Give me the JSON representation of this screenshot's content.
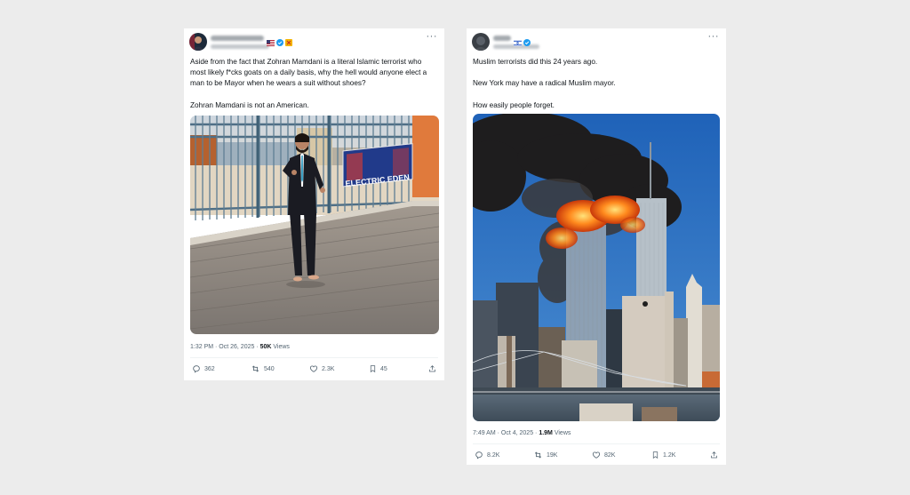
{
  "posts": [
    {
      "text": "Aside from the fact that Zohran Mamdani is a literal Islamic terrorist who most likely f*cks goats on a daily basis, why the hell would anyone elect a man to be Mayor when he wears a suit without shoes?\n\nZohran Mamdani is not an American.",
      "image_text": "ELECTRIC EDEN",
      "timestamp": "1:32 PM · Oct 26, 2025 · ",
      "views_count": "50K",
      "views_label": " Views",
      "replies": "362",
      "reposts": "540",
      "likes": "2.3K",
      "bookmarks": "45"
    },
    {
      "text": "Muslim terrorists did this 24 years ago.\n\nNew York may have a radical Muslim mayor.\n\nHow easily people forget.",
      "timestamp": "7:49 AM · Oct 4, 2025 · ",
      "views_count": "1.9M",
      "views_label": " Views",
      "replies": "8.2K",
      "reposts": "19K",
      "likes": "82K",
      "bookmarks": "1.2K"
    }
  ],
  "colors": {
    "background": "#ececec",
    "card": "#ffffff",
    "verified": "#1d9bf0",
    "text": "#0f1419",
    "muted": "#536471"
  },
  "icons": [
    "more-icon",
    "reply-icon",
    "repost-icon",
    "like-icon",
    "bookmark-icon",
    "share-icon",
    "verified-badge-icon"
  ]
}
